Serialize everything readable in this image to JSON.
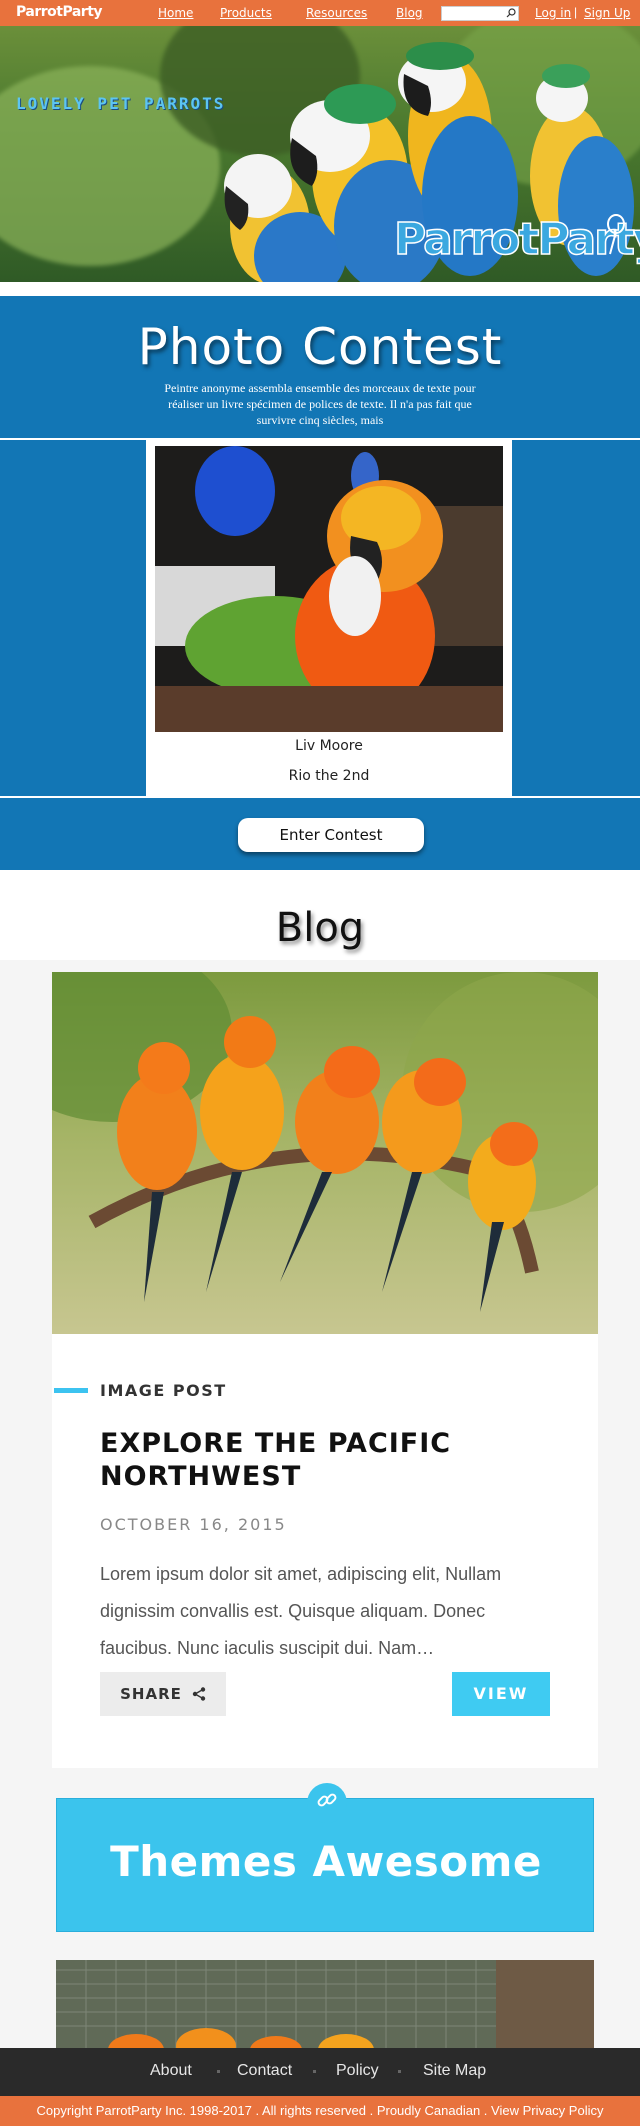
{
  "nav": {
    "logo": "ParrotParty",
    "links": [
      "Home",
      "Products",
      "Resources",
      "Blog"
    ],
    "search_placeholder": "",
    "login": "Log in",
    "separator": "|",
    "signup": "Sign Up"
  },
  "hero": {
    "title": "LOVELY PET PARROTS",
    "brand": "ParrotParty"
  },
  "contest": {
    "title": "Photo Contest",
    "description": "Peintre anonyme assembla ensemble des morceaux de texte pour réaliser un livre spécimen de polices de texte. Il n'a pas fait que survivre cinq siècles, mais",
    "entry_name": "Liv Moore",
    "entry_pet": "Rio the 2nd",
    "enter_button": "Enter Contest"
  },
  "blog": {
    "heading": "Blog",
    "post": {
      "type": "IMAGE POST",
      "title": "EXPLORE THE PACIFIC NORTHWEST",
      "date": "OCTOBER 16, 2015",
      "excerpt": "Lorem ipsum dolor sit amet,  adipiscing elit, Nullam dignissim convallis est. Quisque aliquam. Donec faucibus. Nunc iaculis suscipit dui. Nam…",
      "share": "SHARE",
      "view": "VIEW"
    },
    "banner": "Themes Awesome"
  },
  "footer": {
    "links": [
      "About",
      "Contact",
      "Policy",
      "Site Map"
    ],
    "copyright": "Copyright ParrotParty Inc. 1998-2017 . All rights reserved . Proudly Canadian . View Privacy Policy"
  },
  "colors": {
    "nav_orange": "#e8723d",
    "contest_blue": "#1276b5",
    "accent_cyan": "#3fcbf2",
    "footer_dark": "#2a2a2a"
  }
}
